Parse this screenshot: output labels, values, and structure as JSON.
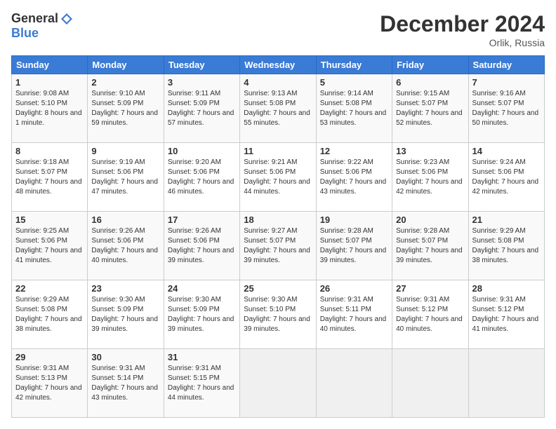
{
  "header": {
    "logo_general": "General",
    "logo_blue": "Blue",
    "month_title": "December 2024",
    "location": "Orlik, Russia"
  },
  "weekdays": [
    "Sunday",
    "Monday",
    "Tuesday",
    "Wednesday",
    "Thursday",
    "Friday",
    "Saturday"
  ],
  "weeks": [
    [
      {
        "day": "1",
        "sunrise": "9:08 AM",
        "sunset": "5:10 PM",
        "daylight": "8 hours and 1 minute."
      },
      {
        "day": "2",
        "sunrise": "9:10 AM",
        "sunset": "5:09 PM",
        "daylight": "7 hours and 59 minutes."
      },
      {
        "day": "3",
        "sunrise": "9:11 AM",
        "sunset": "5:09 PM",
        "daylight": "7 hours and 57 minutes."
      },
      {
        "day": "4",
        "sunrise": "9:13 AM",
        "sunset": "5:08 PM",
        "daylight": "7 hours and 55 minutes."
      },
      {
        "day": "5",
        "sunrise": "9:14 AM",
        "sunset": "5:08 PM",
        "daylight": "7 hours and 53 minutes."
      },
      {
        "day": "6",
        "sunrise": "9:15 AM",
        "sunset": "5:07 PM",
        "daylight": "7 hours and 52 minutes."
      },
      {
        "day": "7",
        "sunrise": "9:16 AM",
        "sunset": "5:07 PM",
        "daylight": "7 hours and 50 minutes."
      }
    ],
    [
      {
        "day": "8",
        "sunrise": "9:18 AM",
        "sunset": "5:07 PM",
        "daylight": "7 hours and 48 minutes."
      },
      {
        "day": "9",
        "sunrise": "9:19 AM",
        "sunset": "5:06 PM",
        "daylight": "7 hours and 47 minutes."
      },
      {
        "day": "10",
        "sunrise": "9:20 AM",
        "sunset": "5:06 PM",
        "daylight": "7 hours and 46 minutes."
      },
      {
        "day": "11",
        "sunrise": "9:21 AM",
        "sunset": "5:06 PM",
        "daylight": "7 hours and 44 minutes."
      },
      {
        "day": "12",
        "sunrise": "9:22 AM",
        "sunset": "5:06 PM",
        "daylight": "7 hours and 43 minutes."
      },
      {
        "day": "13",
        "sunrise": "9:23 AM",
        "sunset": "5:06 PM",
        "daylight": "7 hours and 42 minutes."
      },
      {
        "day": "14",
        "sunrise": "9:24 AM",
        "sunset": "5:06 PM",
        "daylight": "7 hours and 42 minutes."
      }
    ],
    [
      {
        "day": "15",
        "sunrise": "9:25 AM",
        "sunset": "5:06 PM",
        "daylight": "7 hours and 41 minutes."
      },
      {
        "day": "16",
        "sunrise": "9:26 AM",
        "sunset": "5:06 PM",
        "daylight": "7 hours and 40 minutes."
      },
      {
        "day": "17",
        "sunrise": "9:26 AM",
        "sunset": "5:06 PM",
        "daylight": "7 hours and 39 minutes."
      },
      {
        "day": "18",
        "sunrise": "9:27 AM",
        "sunset": "5:07 PM",
        "daylight": "7 hours and 39 minutes."
      },
      {
        "day": "19",
        "sunrise": "9:28 AM",
        "sunset": "5:07 PM",
        "daylight": "7 hours and 39 minutes."
      },
      {
        "day": "20",
        "sunrise": "9:28 AM",
        "sunset": "5:07 PM",
        "daylight": "7 hours and 39 minutes."
      },
      {
        "day": "21",
        "sunrise": "9:29 AM",
        "sunset": "5:08 PM",
        "daylight": "7 hours and 38 minutes."
      }
    ],
    [
      {
        "day": "22",
        "sunrise": "9:29 AM",
        "sunset": "5:08 PM",
        "daylight": "7 hours and 38 minutes."
      },
      {
        "day": "23",
        "sunrise": "9:30 AM",
        "sunset": "5:09 PM",
        "daylight": "7 hours and 39 minutes."
      },
      {
        "day": "24",
        "sunrise": "9:30 AM",
        "sunset": "5:09 PM",
        "daylight": "7 hours and 39 minutes."
      },
      {
        "day": "25",
        "sunrise": "9:30 AM",
        "sunset": "5:10 PM",
        "daylight": "7 hours and 39 minutes."
      },
      {
        "day": "26",
        "sunrise": "9:31 AM",
        "sunset": "5:11 PM",
        "daylight": "7 hours and 40 minutes."
      },
      {
        "day": "27",
        "sunrise": "9:31 AM",
        "sunset": "5:12 PM",
        "daylight": "7 hours and 40 minutes."
      },
      {
        "day": "28",
        "sunrise": "9:31 AM",
        "sunset": "5:12 PM",
        "daylight": "7 hours and 41 minutes."
      }
    ],
    [
      {
        "day": "29",
        "sunrise": "9:31 AM",
        "sunset": "5:13 PM",
        "daylight": "7 hours and 42 minutes."
      },
      {
        "day": "30",
        "sunrise": "9:31 AM",
        "sunset": "5:14 PM",
        "daylight": "7 hours and 43 minutes."
      },
      {
        "day": "31",
        "sunrise": "9:31 AM",
        "sunset": "5:15 PM",
        "daylight": "7 hours and 44 minutes."
      },
      null,
      null,
      null,
      null
    ]
  ],
  "labels": {
    "sunrise_prefix": "Sunrise: ",
    "sunset_prefix": "Sunset: ",
    "daylight_prefix": "Daylight: "
  }
}
